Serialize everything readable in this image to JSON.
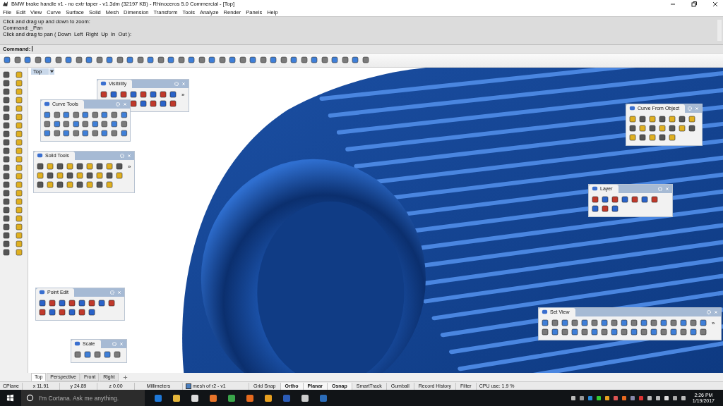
{
  "window": {
    "title": "BMW brake handle v1 - no extr taper - v1.3dm (32197 KB) - Rhinoceros 5.0 Commercial - [Top]"
  },
  "menu": [
    "File",
    "Edit",
    "View",
    "Curve",
    "Surface",
    "Solid",
    "Mesh",
    "Dimension",
    "Transform",
    "Tools",
    "Analyze",
    "Render",
    "Panels",
    "Help"
  ],
  "command_history": [
    "Click and drag up and down to zoom:",
    "Command: _Pan",
    "Click and drag to pan ( Down  Left  Right  Up  In  Out ):"
  ],
  "command_prompt": {
    "label": "Command:"
  },
  "viewport": {
    "label": "Top"
  },
  "panels": [
    {
      "title": "Visibility",
      "overflow": "»"
    },
    {
      "title": "Curve Tools"
    },
    {
      "title": "Solid Tools",
      "overflow": "»"
    },
    {
      "title": "Point Edit"
    },
    {
      "title": "Scale"
    },
    {
      "title": "Curve From Object"
    },
    {
      "title": "Layer"
    },
    {
      "title": "Set View",
      "overflow": "»"
    }
  ],
  "viewport_tabs": [
    {
      "label": "Top",
      "selected": true
    },
    {
      "label": "Perspective",
      "selected": false
    },
    {
      "label": "Front",
      "selected": false
    },
    {
      "label": "Right",
      "selected": false
    }
  ],
  "status_bar": {
    "cplane": "CPlane",
    "x": "x 11.91",
    "y": "y 24.89",
    "z": "z 0.00",
    "units": "Millimeters",
    "layer": "mesh of r2 - v1",
    "panes": [
      {
        "label": "Grid Snap",
        "on": false
      },
      {
        "label": "Ortho",
        "on": true
      },
      {
        "label": "Planar",
        "on": true
      },
      {
        "label": "Osnap",
        "on": true
      },
      {
        "label": "SmartTrack",
        "on": false
      },
      {
        "label": "Gumball",
        "on": false
      },
      {
        "label": "Record History",
        "on": false
      },
      {
        "label": "Filter",
        "on": false
      }
    ],
    "cpu": "CPU use: 1.9 %"
  },
  "taskbar": {
    "search_placeholder": "I'm Cortana. Ask me anything.",
    "time": "2:26 PM",
    "date": "1/19/2017"
  }
}
